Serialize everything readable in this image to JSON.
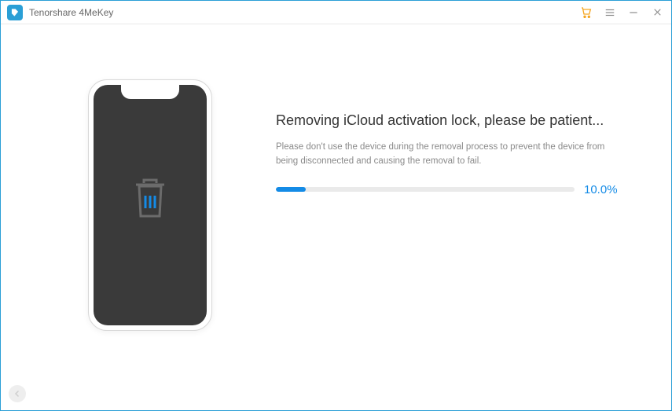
{
  "titlebar": {
    "app_name": "Tenorshare 4MeKey"
  },
  "main": {
    "heading": "Removing iCloud activation lock, please be patient...",
    "subtext": "Please don't use the device during the removal process to prevent the device from being disconnected and causing the removal to fail.",
    "progress_percent": 10,
    "progress_label": "10.0%"
  },
  "icons": {
    "logo": "app-logo",
    "cart": "cart-icon",
    "menu": "menu-icon",
    "minimize": "minimize-icon",
    "close": "close-icon",
    "trash": "trash-icon",
    "back": "back-icon"
  },
  "colors": {
    "accent": "#148be6",
    "titlebar_border": "#2a9fd6",
    "cart": "#f5a623"
  }
}
